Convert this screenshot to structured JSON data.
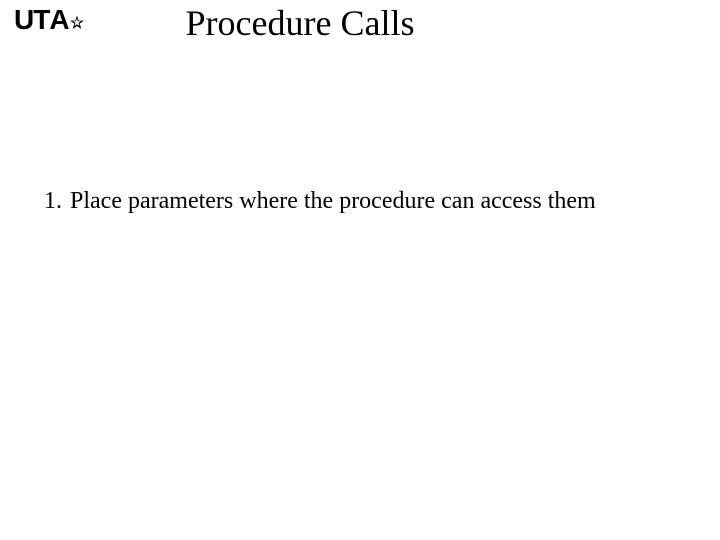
{
  "logo": {
    "text_ut": "UT",
    "text_a": "A"
  },
  "title": "Procedure Calls",
  "list": {
    "items": [
      {
        "number": "1.",
        "text": "Place parameters where the procedure can access them"
      }
    ]
  }
}
